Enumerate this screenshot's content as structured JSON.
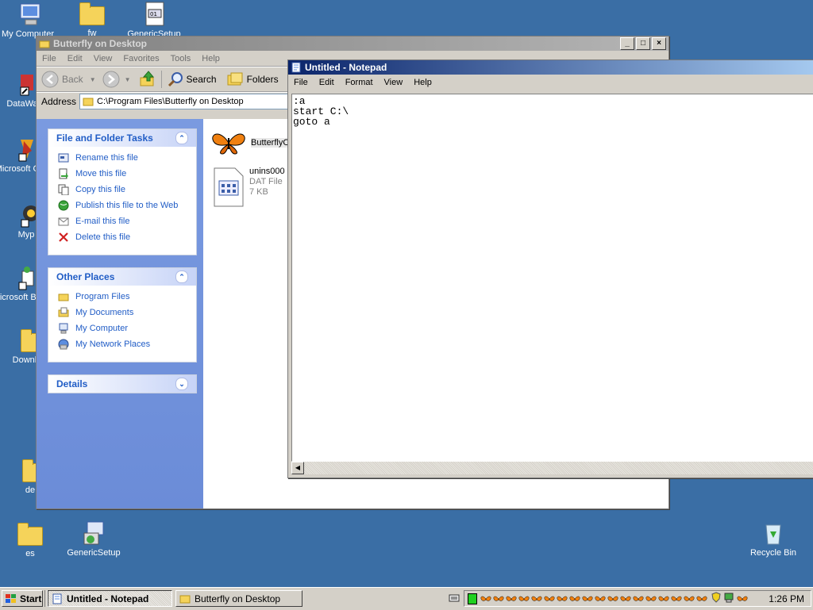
{
  "desktop": {
    "icons": [
      {
        "label": "My Computer"
      },
      {
        "label": "fw"
      },
      {
        "label": "GenericSetup"
      },
      {
        "label": "DataWa"
      },
      {
        "label": "Microsoft C++"
      },
      {
        "label": "Myp"
      },
      {
        "label": "Microsoft Basic"
      },
      {
        "label": "Downlo"
      },
      {
        "label": "de"
      },
      {
        "label": "es"
      },
      {
        "label": "GenericSetup"
      },
      {
        "label": "Recycle Bin"
      }
    ]
  },
  "explorer": {
    "title": "Butterfly on Desktop",
    "menu": [
      "File",
      "Edit",
      "View",
      "Favorites",
      "Tools",
      "Help"
    ],
    "toolbar": {
      "back": "Back",
      "search": "Search",
      "folders": "Folders"
    },
    "address_label": "Address",
    "address_value": "C:\\Program Files\\Butterfly on Desktop",
    "file_tasks": {
      "title": "File and Folder Tasks",
      "items": [
        "Rename this file",
        "Move this file",
        "Copy this file",
        "Publish this file to the Web",
        "E-mail this file",
        "Delete this file"
      ]
    },
    "other_places": {
      "title": "Other Places",
      "items": [
        "Program Files",
        "My Documents",
        "My Computer",
        "My Network Places"
      ]
    },
    "details": {
      "title": "Details"
    },
    "files": [
      {
        "name": "ButterflyO"
      },
      {
        "name": "unins000",
        "type": "DAT File",
        "size": "7 KB"
      }
    ]
  },
  "notepad": {
    "title": "Untitled - Notepad",
    "menu": [
      "File",
      "Edit",
      "Format",
      "View",
      "Help"
    ],
    "text": ":a\nstart C:\\\ngoto a"
  },
  "taskbar": {
    "start": "Start",
    "tasks": [
      "Untitled - Notepad",
      "Butterfly on Desktop"
    ],
    "clock": "1:26 PM"
  }
}
